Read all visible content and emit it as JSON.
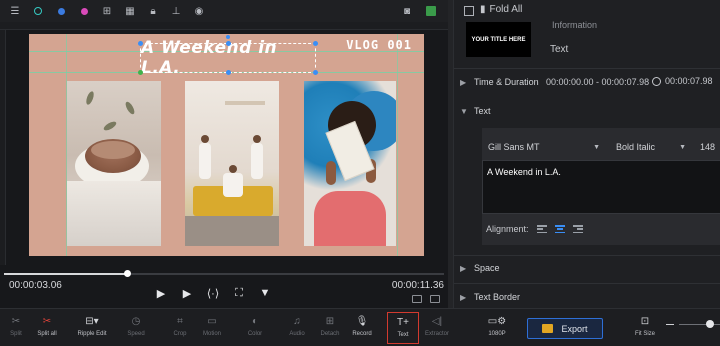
{
  "canvas": {
    "vlog_label": "VLOG 001",
    "title_text": "A Weekend in L.A.",
    "background_color": "#d4a491"
  },
  "playback": {
    "current_time": "00:00:03.06",
    "total_time": "00:00:11.36",
    "progress_fraction": 0.28
  },
  "inspector": {
    "fold_all_label": "Fold All",
    "thumbnail_text": "YOUR TITLE HERE",
    "information_label": "Information",
    "information_value": "Text",
    "time_duration": {
      "label": "Time & Duration",
      "range": "00:00:00.00 - 00:00:07.98",
      "duration": "00:00:07.98"
    },
    "text_section": {
      "label": "Text",
      "font": "Gill Sans MT",
      "style": "Bold Italic",
      "size": "148",
      "content": "A Weekend in L.A.",
      "alignment_label": "Alignment:",
      "alignment_selected": "center"
    },
    "space_label": "Space",
    "text_border_label": "Text Border"
  },
  "toolbar": {
    "split": "Split",
    "split_all": "Split all",
    "ripple_edit": "Ripple Edit",
    "speed": "Speed",
    "crop": "Crop",
    "motion": "Motion",
    "color": "Color",
    "audio": "Audio",
    "detach": "Detach",
    "record": "Record",
    "text": "Text",
    "extractor": "Extractor",
    "resolution": "1080P",
    "export": "Export",
    "fit_size": "Fit Size"
  },
  "colors": {
    "accent_blue": "#3a8ef5",
    "highlight_red": "#d23a2f",
    "export_yellow": "#e2a623",
    "guide_green": "#6fd6a8"
  }
}
